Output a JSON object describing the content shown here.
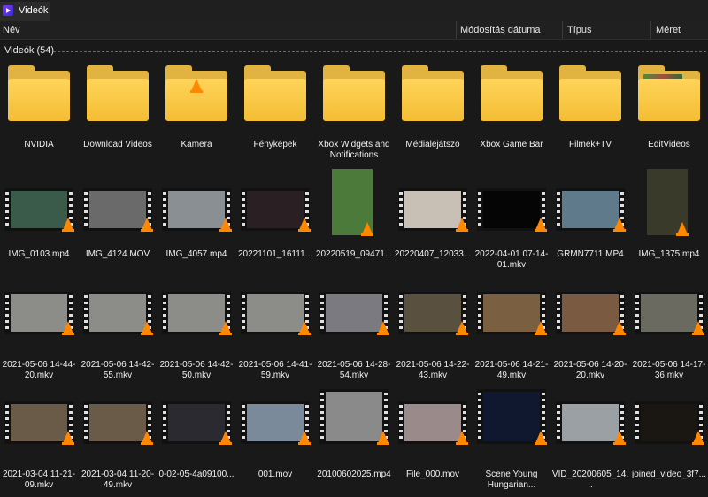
{
  "window": {
    "title": "Videók",
    "icon": "video-app-icon"
  },
  "columns": {
    "name": "Név",
    "date": "Módosítás dátuma",
    "type": "Típus",
    "size": "Méret"
  },
  "group": {
    "title": "Videók (54)"
  },
  "folders": [
    {
      "label": "NVIDIA",
      "icon": "folder-icon"
    },
    {
      "label": "Download Videos",
      "icon": "folder-icon"
    },
    {
      "label": "Kamera",
      "icon": "folder-vlc-icon"
    },
    {
      "label": "Fényképek",
      "icon": "folder-icon"
    },
    {
      "label": "Xbox Widgets and Notifications",
      "icon": "folder-icon"
    },
    {
      "label": "Médialejátszó",
      "icon": "folder-icon"
    },
    {
      "label": "Xbox Game Bar",
      "icon": "folder-icon"
    },
    {
      "label": "Filmek+TV",
      "icon": "folder-icon"
    },
    {
      "label": "EditVideos",
      "icon": "folder-photo-icon"
    }
  ],
  "files_row1": [
    {
      "label": "IMG_0103.mp4",
      "color": "#3a5a4a"
    },
    {
      "label": "IMG_4124.MOV",
      "color": "#6a6a6a"
    },
    {
      "label": "IMG_4057.mp4",
      "color": "#8a8f94"
    },
    {
      "label": "20221101_16111...",
      "color": "#2a1f22"
    },
    {
      "label": "20220519_09471...",
      "color": "#4c7a3a"
    },
    {
      "label": "20220407_12033...",
      "color": "#c8c0b4"
    },
    {
      "label": "2022-04-01 07-14-01.mkv",
      "color": "#050505"
    },
    {
      "label": "GRMN7711.MP4",
      "color": "#5f7a8a"
    },
    {
      "label": "IMG_1375.mp4",
      "color": "#3a3a2a"
    }
  ],
  "files_row2": [
    {
      "label": "2021-05-06 14-44-20.mkv",
      "color": "#8c8c88"
    },
    {
      "label": "2021-05-06 14-42-55.mkv",
      "color": "#8c8c88"
    },
    {
      "label": "2021-05-06 14-42-50.mkv",
      "color": "#8c8c88"
    },
    {
      "label": "2021-05-06 14-41-59.mkv",
      "color": "#8c8c88"
    },
    {
      "label": "2021-05-06 14-28-54.mkv",
      "color": "#7a7a80"
    },
    {
      "label": "2021-05-06 14-22-43.mkv",
      "color": "#5a5040"
    },
    {
      "label": "2021-05-06 14-21-49.mkv",
      "color": "#7a6040"
    },
    {
      "label": "2021-05-06 14-20-20.mkv",
      "color": "#7a5a40"
    },
    {
      "label": "2021-05-06 14-17-36.mkv",
      "color": "#6a6a60"
    }
  ],
  "files_row3": [
    {
      "label": "2021-03-04 11-21-09.mkv",
      "color": "#6a5a48"
    },
    {
      "label": "2021-03-04 11-20-49.mkv",
      "color": "#6a5a48"
    },
    {
      "label": "0-02-05-4a09100...",
      "color": "#2a2a30"
    },
    {
      "label": "001.mov",
      "color": "#7a8a9a"
    },
    {
      "label": "20100602025.mp4",
      "color": "#8a8a8a"
    },
    {
      "label": "File_000.mov",
      "color": "#9a8a8a"
    },
    {
      "label": "Scene Young Hungarian...",
      "color": "#101830"
    },
    {
      "label": "VID_20200605_14...",
      "color": "#9aa0a4"
    },
    {
      "label": "joined_video_3f7...",
      "color": "#1a1612"
    }
  ]
}
